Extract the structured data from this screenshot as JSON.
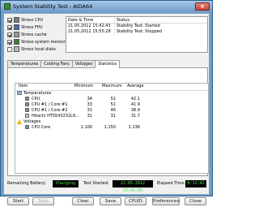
{
  "window": {
    "title": "System Stability Test - AIDA64",
    "icons": {
      "app": "aida64-app-icon",
      "close": "close-icon"
    },
    "colors": {
      "frame": "#6f9cc8",
      "panel": "#f0f0f0",
      "led_bg": "#000000",
      "led_text": "#4be04b"
    }
  },
  "stress": [
    {
      "label": "Stress CPU",
      "checked": true,
      "icon": "cpu-icon"
    },
    {
      "label": "Stress FPU",
      "checked": true,
      "icon": "fpu-icon"
    },
    {
      "label": "Stress cache",
      "checked": true,
      "icon": "cache-icon"
    },
    {
      "label": "Stress system memory",
      "checked": true,
      "icon": "memory-icon"
    },
    {
      "label": "Stress local disks",
      "checked": false,
      "icon": "disk-icon"
    }
  ],
  "log": {
    "headers": [
      "Date & Time",
      "Status"
    ],
    "rows": [
      {
        "datetime": "21.05.2012 15:42:43",
        "status": "Stability Test: Started"
      },
      {
        "datetime": "21.05.2012 15:55:28",
        "status": "Stability Test: Stopped"
      }
    ]
  },
  "tabs": [
    "Temperatures",
    "Cooling Fans",
    "Voltages",
    "Statistics"
  ],
  "active_tab": "Statistics",
  "stats": {
    "headers": {
      "item": "Item",
      "min": "Minimum",
      "max": "Maximum",
      "avg": "Average"
    },
    "groups": {
      "temperatures": "Temperatures",
      "voltages": "Voltages"
    },
    "rows": [
      {
        "item": "CPU",
        "min": "34",
        "max": "52",
        "avg": "42.1",
        "icon": "cpu-icon"
      },
      {
        "item": "CPU #1 / Core #1",
        "min": "33",
        "max": "51",
        "avg": "41.9",
        "icon": "cpu-icon"
      },
      {
        "item": "CPU #1 / Core #2",
        "min": "31",
        "max": "46",
        "avg": "38.9",
        "icon": "cpu-icon"
      },
      {
        "item": "Hitachi HTS543232L9...",
        "min": "31",
        "max": "31",
        "avg": "31.7",
        "icon": "disk-icon"
      },
      {
        "item": "CPU Core",
        "min": "1.100",
        "max": "1.150",
        "avg": "1.136",
        "icon": "voltage-icon"
      }
    ]
  },
  "footer": {
    "remaining_battery_label": "Remaining Battery:",
    "remaining_battery_value": "Charging",
    "test_started_label": "Test Started:",
    "test_started_value": "21.05.2012 15:42:43",
    "elapsed_label": "Elapsed Time:",
    "elapsed_value": "0:12:42"
  },
  "buttons": {
    "start": "Start",
    "stop": "Stop",
    "clear": "Clear",
    "save": "Save",
    "cpuid": "CPUID",
    "preferences": "Preferences",
    "close": "Close"
  }
}
